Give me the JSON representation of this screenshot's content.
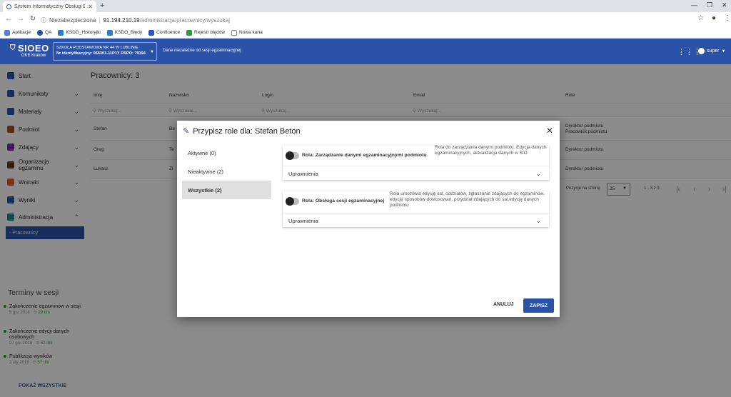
{
  "browser": {
    "tab_title": "System Informatyczny Obsługi E",
    "url_insecure": "Niezabezpieczona",
    "url_host": "91.194.210.19",
    "url_path": "/administracja/pracownicy/wyszukaj",
    "bookmarks": [
      {
        "label": "Aplikacje",
        "color": "#5b7bd5"
      },
      {
        "label": "QA",
        "color": "#2a52a8"
      },
      {
        "label": "KSDO_Historyjki",
        "color": "#2a7bd5"
      },
      {
        "label": "KSDO_Błędy",
        "color": "#2a7bd5"
      },
      {
        "label": "Confluence",
        "color": "#2656c9"
      },
      {
        "label": "Rejestr błędów",
        "color": "#2e9b3e"
      },
      {
        "label": "Nowa karta",
        "color": "#888888"
      }
    ]
  },
  "app": {
    "logo": "SIOEO",
    "logo_sub": "OKE Kraków",
    "school_line1": "SZKOŁA PODSTAWOWA NR 44 W LUBLINIE",
    "school_line2": "Nr identyfikacyjny: 066301-11P1Y RSPO: 79194",
    "no_session": "Dane niezależne od sesji egzaminacyjnej",
    "user": "super",
    "accent": "#2a52a8"
  },
  "sidebar": {
    "items": [
      {
        "label": "Start",
        "icon": "dashboard-icon",
        "color": "#2a52a8"
      },
      {
        "label": "Komunikaty",
        "icon": "message-icon",
        "color": "#2a52a8"
      },
      {
        "label": "Materiały",
        "icon": "folder-icon",
        "color": "#2a52a8"
      },
      {
        "label": "Podmiot",
        "icon": "building-icon",
        "color": "#a0522d"
      },
      {
        "label": "Zdający",
        "icon": "student-icon",
        "color": "#7b2fa8"
      },
      {
        "label": "Organizacja egzaminu",
        "icon": "briefcase-icon",
        "color": "#5a3b1e"
      },
      {
        "label": "Wnioski",
        "icon": "request-icon",
        "color": "#e2582a"
      },
      {
        "label": "Wyniki",
        "icon": "results-icon",
        "color": "#2a52a8"
      },
      {
        "label": "Administracja",
        "icon": "shield-icon",
        "color": "#1f8a86"
      }
    ],
    "sub_item": "- Pracownicy",
    "terms_title": "Terminy w sesji",
    "terms": [
      {
        "name": "Zakończenie egzaminów w sesji",
        "date": "5 gru 2018",
        "days": "29 dni"
      },
      {
        "name": "Zakończenie edycji danych osobowych",
        "date": "27 gru 2018",
        "days": "52 dni"
      },
      {
        "name": "Publikacja wyników",
        "date": "2 sty 2019",
        "days": "57 dni"
      }
    ],
    "show_all": "POKAŻ WSZYSTKIE"
  },
  "main": {
    "title": "Pracownicy: 3",
    "columns": [
      "Imię",
      "Nazwisko",
      "Login",
      "Email",
      "Role"
    ],
    "search_placeholder": "Wyszukaj...",
    "rows": [
      {
        "first": "Stefan",
        "last": "Be",
        "roles1": "Dyrektor podmiotu",
        "roles2": "Pracownik podmiotu"
      },
      {
        "first": "Greg",
        "last": "Te",
        "roles1": "Dyrektor podmiotu",
        "roles2": ""
      },
      {
        "first": "Łukasz",
        "last": "Zi",
        "roles1": "Dyrektor podmiotu",
        "roles2": ""
      }
    ],
    "per_page_label": "Pozycje na stronę",
    "per_page": "25",
    "range": "1 - 3 z 3"
  },
  "modal": {
    "title": "Przypisz role dla: Stefan Beton",
    "tabs": [
      "Aktywne (0)",
      "Nieaktywne (2)",
      "Wszystkie (2)"
    ],
    "active_tab": 2,
    "roles": [
      {
        "name": "Rola: Zarządzanie danymi egzaminacyjnymi podmiotu",
        "desc": "Rola do zarządzania danymi podmiotu. Edycja danych egzaminacyjnych, aktualizacja danych w SIO",
        "perm_label": "Uprawnienia"
      },
      {
        "name": "Rola: Obsługa sesji egzaminacyjnej",
        "desc": "Rola umożliwia edycję sal, oddziałów, zgłaszanie zdających do egzaminów, edycję sposobów dostosowań, przydział zdających do sal,edycję danych podmiotu",
        "perm_label": "Uprawnienia"
      }
    ],
    "cancel": "ANULUJ",
    "save": "ZAPISZ"
  }
}
